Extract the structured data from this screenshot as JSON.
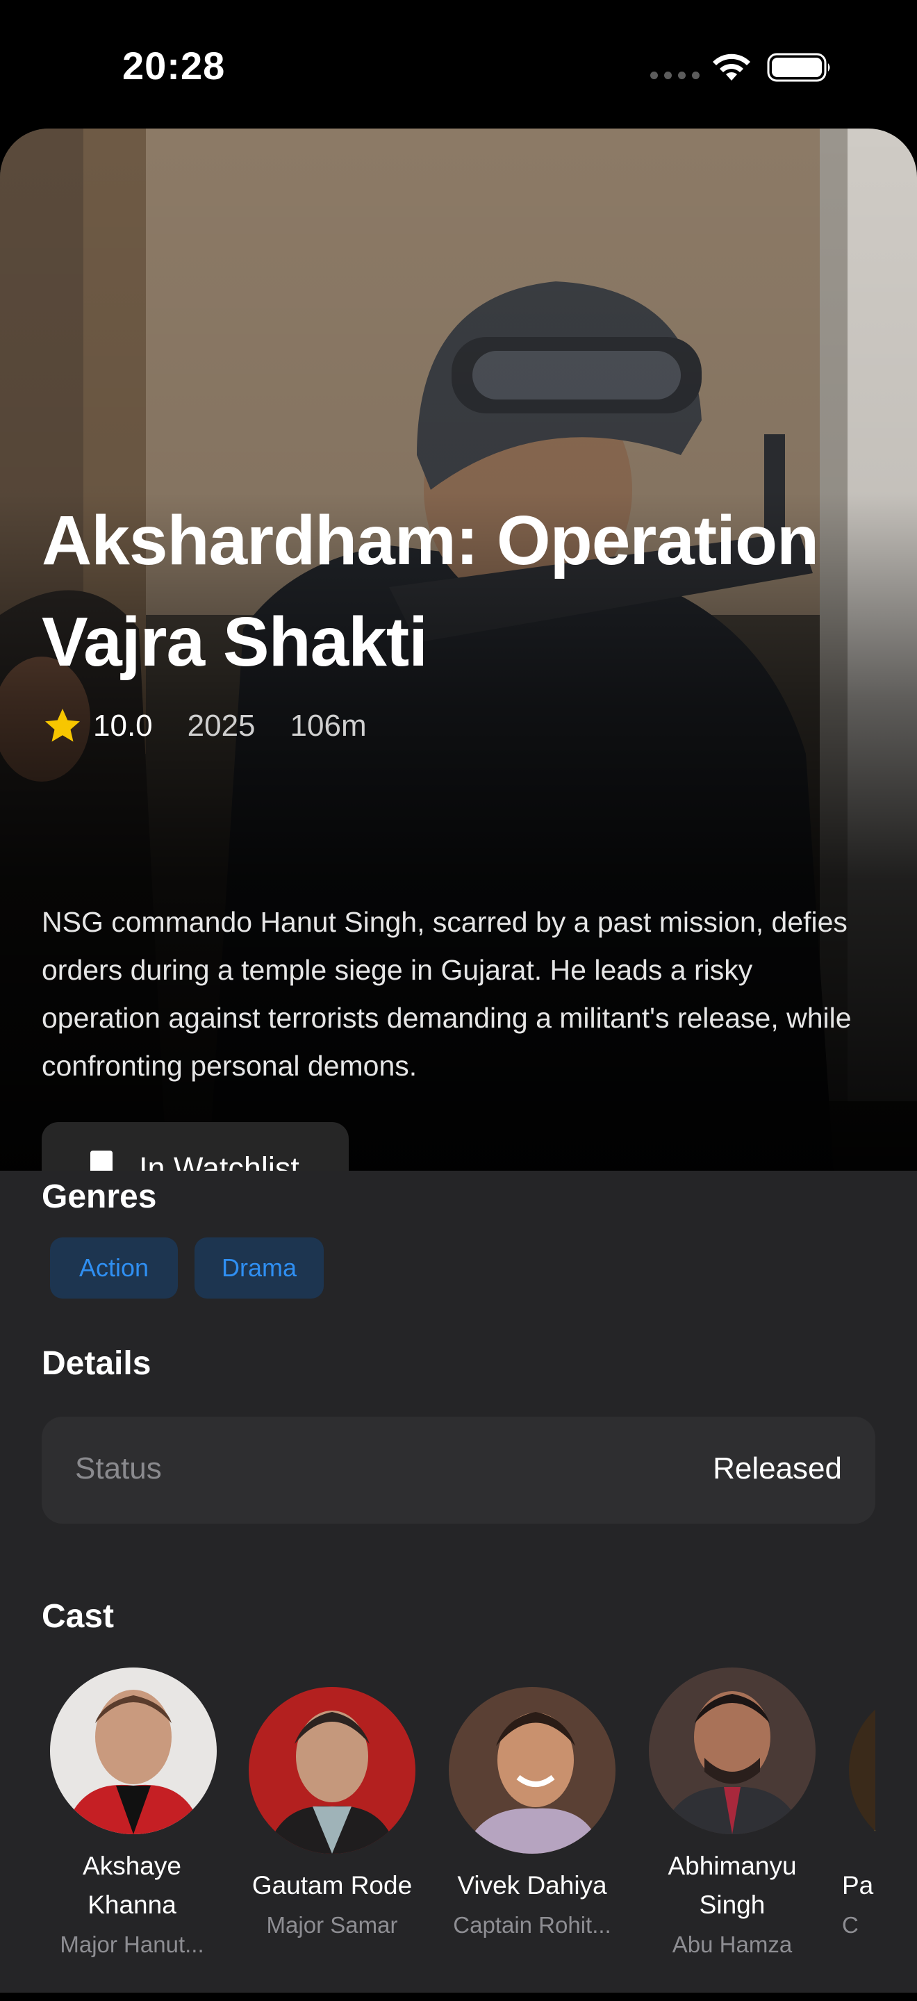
{
  "status_bar": {
    "time": "20:28"
  },
  "movie": {
    "title_line1": "Akshardham: Operation",
    "title_line2": "Vajra Shakti",
    "rating": "10.0",
    "year": "2025",
    "runtime": "106m",
    "overview": "NSG commando Hanut Singh, scarred by a past mission, defies orders during a temple siege in Gujarat. He leads a risky operation against terrorists demanding a militant's release, while confronting personal demons.",
    "watchlist_label": "In Watchlist"
  },
  "genres": {
    "title": "Genres",
    "items": [
      "Action",
      "Drama"
    ]
  },
  "details": {
    "title": "Details",
    "status_label": "Status",
    "status_value": "Released"
  },
  "cast": {
    "title": "Cast",
    "members": [
      {
        "name": "Akshaye Khanna",
        "role": "Major Hanut..."
      },
      {
        "name": "Gautam Rode",
        "role": "Major Samar"
      },
      {
        "name": "Vivek Dahiya",
        "role": "Captain Rohit..."
      },
      {
        "name": "Abhimanyu Singh",
        "role": "Abu Hamza"
      },
      {
        "name": "Pa",
        "role": "C"
      }
    ]
  },
  "colors": {
    "accent": "#2f8ff2",
    "chip_bg": "#1d3550",
    "star": "#f7c600",
    "content_bg": "#252527",
    "card_bg": "#2e2e30"
  }
}
